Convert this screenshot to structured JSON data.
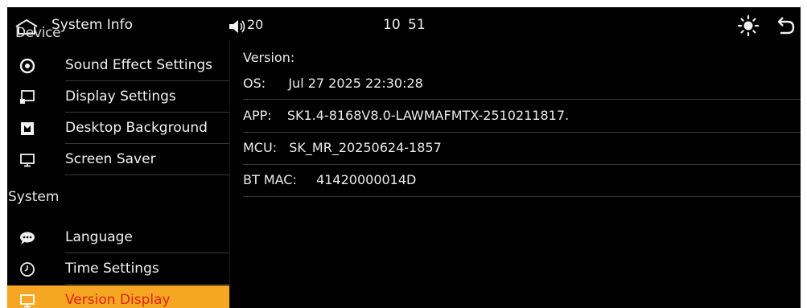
{
  "topbar": {
    "title": "System Info",
    "section_label": "Device",
    "volume": "20",
    "time": "10 51",
    "icons": {
      "home": "home-icon",
      "volume": "speaker-icon",
      "brightness": "sun-icon",
      "back": "back-arrow-icon"
    }
  },
  "sidebar": {
    "device_items": [
      {
        "label": "Sound Effect Settings",
        "icon": "sound-effect-icon"
      },
      {
        "label": "Display Settings",
        "icon": "display-icon"
      },
      {
        "label": "Desktop Background",
        "icon": "wallpaper-icon"
      },
      {
        "label": "Screen Saver",
        "icon": "monitor-icon"
      }
    ],
    "system_header": "System",
    "system_items": [
      {
        "label": "Language",
        "icon": "speech-bubble-icon"
      },
      {
        "label": "Time Settings",
        "icon": "clock-icon"
      },
      {
        "label": "Version Display",
        "icon": "monitor-icon",
        "active": true
      }
    ]
  },
  "version": {
    "heading": "Version:",
    "os_label": "OS:",
    "os_value": "Jul 27 2025 22:30:28",
    "app_label": "APP:",
    "app_value": "SK1.4-8168V8.0-LAWMAFMTX-2510211817.",
    "mcu_label": "MCU:",
    "mcu_value": "SK_MR_20250624-1857",
    "bt_label": "BT MAC:",
    "bt_value": "41420000014D"
  },
  "colors": {
    "active_bg": "#f5a623",
    "active_text": "#e0241b",
    "panel_bg": "#000000"
  }
}
